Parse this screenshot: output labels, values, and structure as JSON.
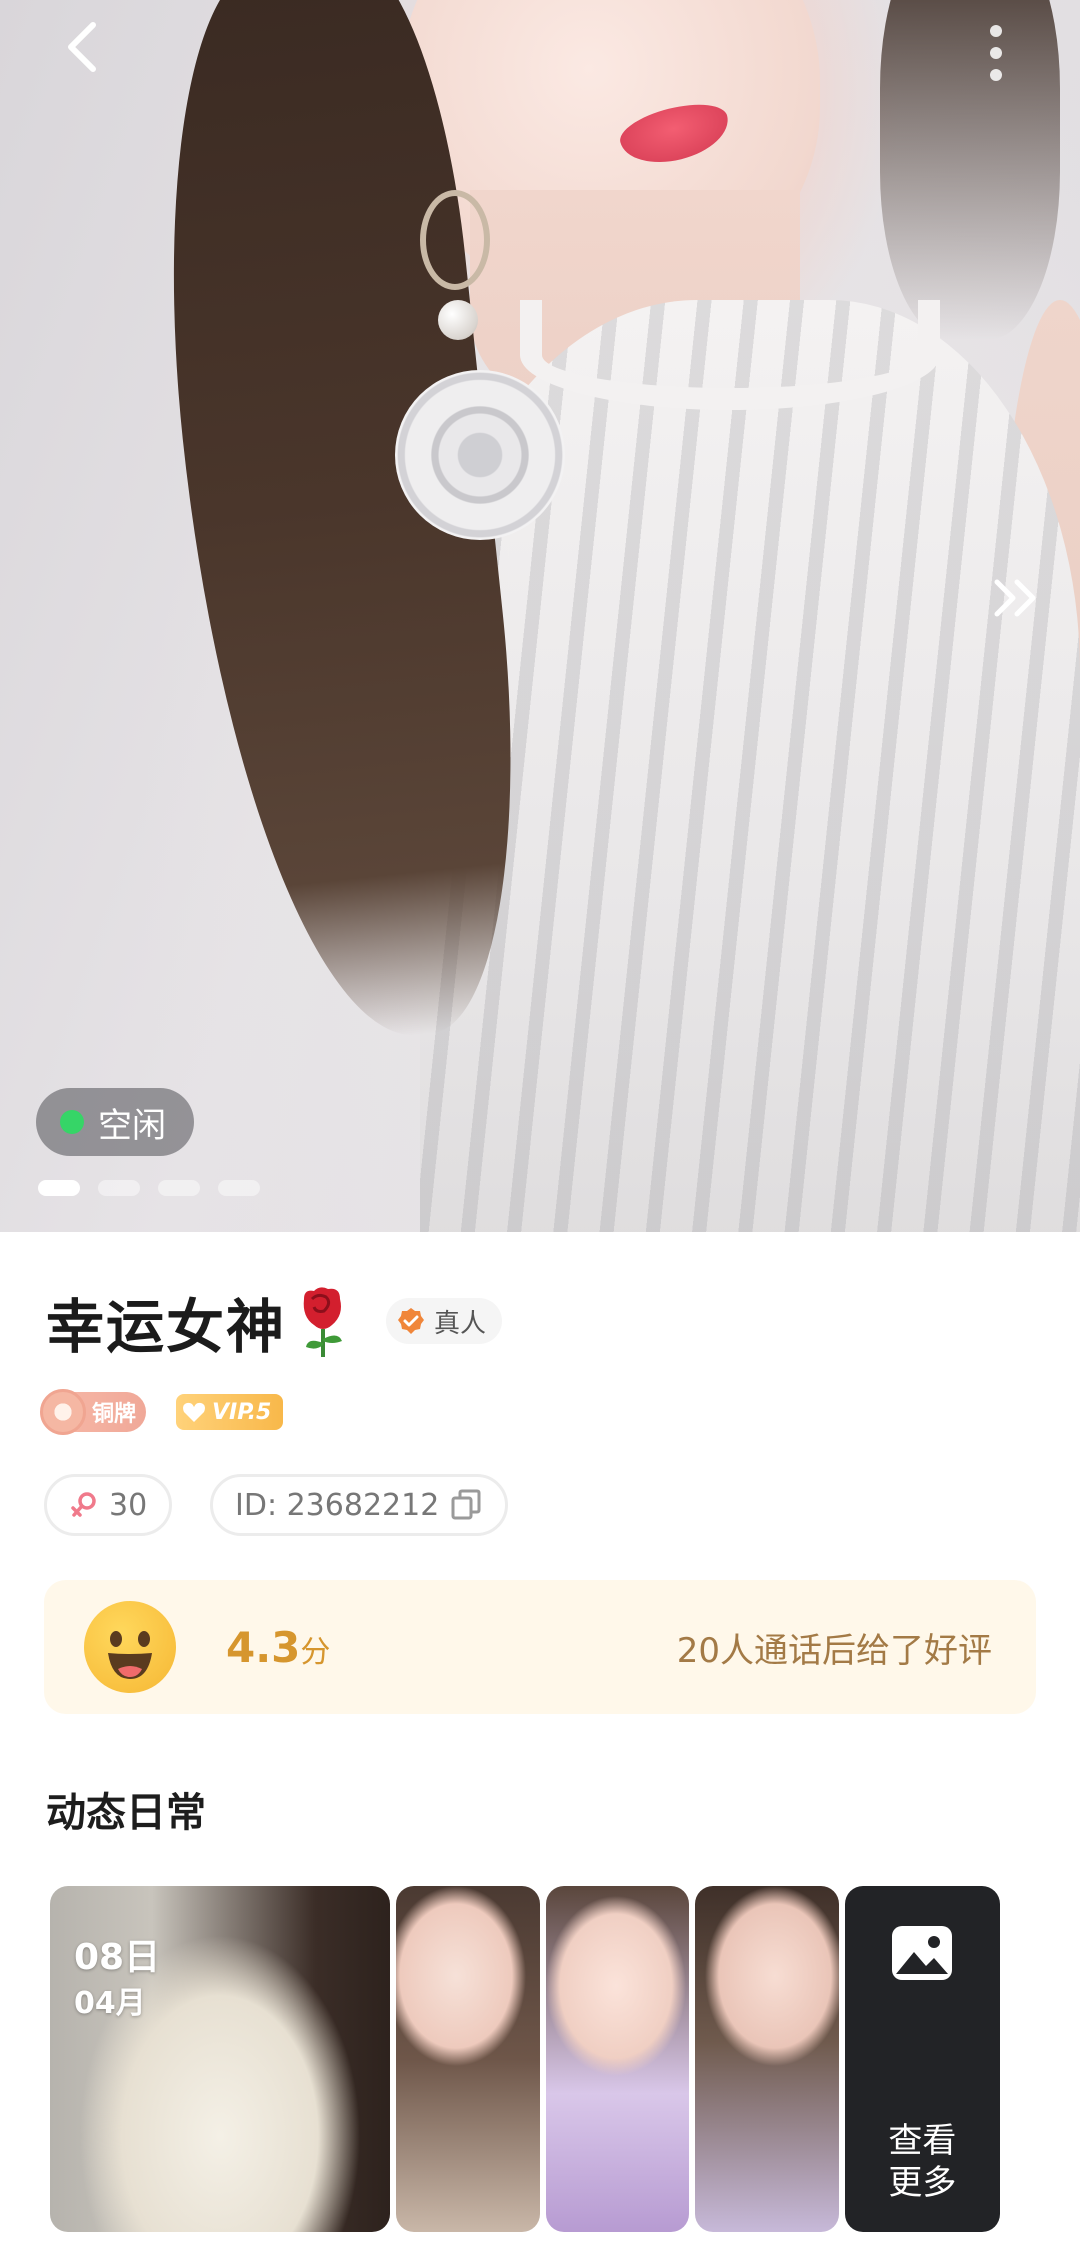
{
  "hero": {
    "status_label": "空闲",
    "status_color": "#36d567",
    "photo_count": 4,
    "active_photo_index": 1
  },
  "profile": {
    "name": "幸运女神",
    "name_emoji": "rose",
    "verified_label": "真人",
    "medal_label": "铜牌",
    "vip_label": "VIP.5",
    "age": "30",
    "id_text": "ID: 23682212"
  },
  "rating": {
    "score": "4.3",
    "score_unit": "分",
    "review_text": "20人通话后给了好评"
  },
  "moments": {
    "title": "动态日常",
    "first_day": "08日",
    "first_month": "04月",
    "more_label": "查看更多"
  },
  "icons": {
    "back": "chevron-left-icon",
    "more": "more-vertical-icon",
    "next": "double-chevron-right-icon",
    "verified": "verified-check-icon",
    "gender": "female-icon",
    "copy": "copy-icon",
    "gallery": "image-icon"
  },
  "colors": {
    "accent_orange": "#d6962e",
    "rating_bg": "#fff8ea",
    "status_green": "#36d567"
  }
}
